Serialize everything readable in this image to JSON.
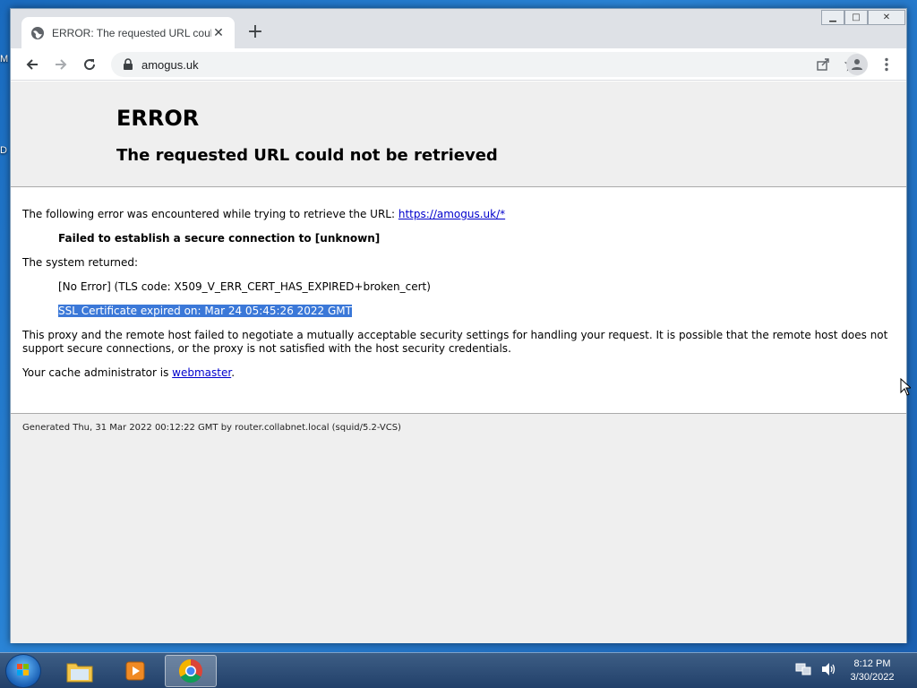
{
  "desktop": {
    "frag_top": "M",
    "frag_mid": "D"
  },
  "tab": {
    "title": "ERROR: The requested URL could not be retrieved"
  },
  "address": {
    "url": "amogus.uk"
  },
  "page": {
    "h1": "ERROR",
    "h2": "The requested URL could not be retrieved",
    "intro": "The following error was encountered while trying to retrieve the URL: ",
    "intro_link": "https://amogus.uk/*",
    "failure": "Failed to establish a secure connection to [unknown]",
    "system_returned": "The system returned:",
    "error_code": "[No Error] (TLS code: X509_V_ERR_CERT_HAS_EXPIRED+broken_cert)",
    "ssl_expired": "SSL Certificate expired on: Mar 24 05:45:26 2022 GMT",
    "explanation": "This proxy and the remote host failed to negotiate a mutually acceptable security settings for handling your request. It is possible that the remote host does not support secure connections, or the proxy is not satisfied with the host security credentials.",
    "admin_prefix": "Your cache administrator is ",
    "admin_link": "webmaster",
    "admin_suffix": ".",
    "generated": "Generated Thu, 31 Mar 2022 00:12:22 GMT by router.collabnet.local (squid/5.2-VCS)"
  },
  "taskbar": {
    "time": "8:12 PM",
    "date": "3/30/2022"
  },
  "colors": {
    "link": "#0000cc",
    "highlight": "#3b78d8",
    "header_bg": "#efefef"
  }
}
